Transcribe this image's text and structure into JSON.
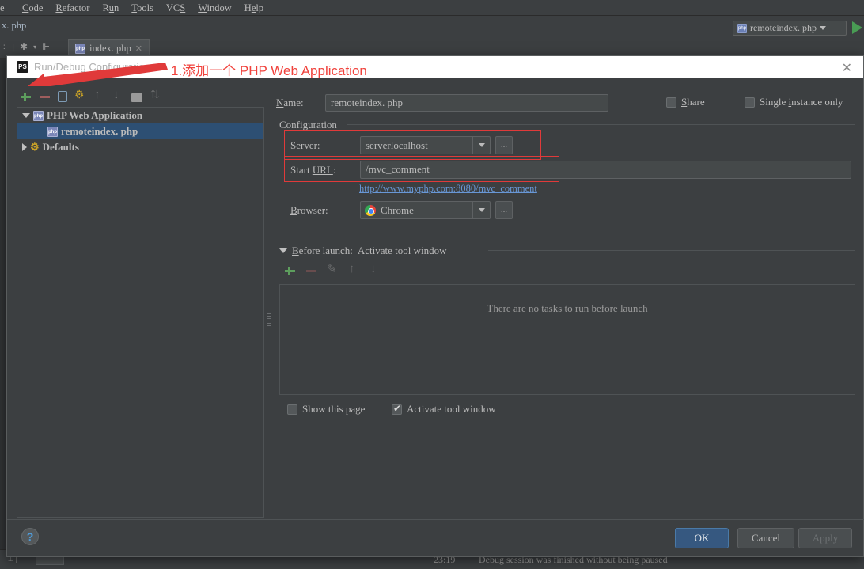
{
  "ide": {
    "menubar": [
      "Code",
      "Refactor",
      "Run",
      "Tools",
      "VCS",
      "Window",
      "Help"
    ],
    "menubar_clipped": "e",
    "breadcrumb": "x. php",
    "file_tab": "index. php",
    "run_config_widget": "remoteindex. php",
    "status": {
      "time": "23:19",
      "message": "Debug session was finished without being paused"
    }
  },
  "dialog": {
    "title": "Run/Debug Configurations",
    "annotation": "1.添加一个 PHP Web Application",
    "close_label": "✕",
    "left_panel": {
      "toolbar": [
        "add-icon",
        "remove-icon",
        "copy-icon",
        "edit-templates-icon",
        "move-up-icon",
        "move-down-icon",
        "folder-icon",
        "sort-icon"
      ],
      "tree": [
        {
          "label": "PHP Web Application",
          "level": 0,
          "expanded": true,
          "selected": false,
          "icon": "php-icon"
        },
        {
          "label": "remoteindex. php",
          "level": 1,
          "expanded": null,
          "selected": true,
          "icon": "php-icon"
        },
        {
          "label": "Defaults",
          "level": 0,
          "expanded": false,
          "selected": false,
          "icon": "defaults-icon"
        }
      ]
    },
    "name_label": "Name:",
    "name_label_u": "N",
    "name_value": "remoteindex. php",
    "share_label": "Share",
    "share_label_u": "S",
    "share_checked": false,
    "single_instance_label": "Single instance only",
    "single_instance_checked": false,
    "configuration_group": "Configuration",
    "server_label": "Server:",
    "server_label_u": "S",
    "server_value": "serverlocalhost",
    "server_dots": "...",
    "start_url_label": "Start URL:",
    "start_url_label_u": "URL",
    "start_url_value": "/mvc_comment",
    "resolved_url": "http://www.myphp.com:8080/mvc_comment",
    "browser_label": "Browser:",
    "browser_label_u": "B",
    "browser_value": "Chrome",
    "browser_dots": "...",
    "before_launch_label": "Before launch:",
    "before_launch_label_u": "B",
    "before_launch_value": "Activate tool window",
    "before_launch_toolbar": [
      "add-task-icon",
      "remove-task-icon",
      "edit-task-icon",
      "move-task-up-icon",
      "move-task-down-icon"
    ],
    "tasks_empty_text": "There are no tasks to run before launch",
    "show_this_page_label": "Show this page",
    "show_this_page_checked": false,
    "activate_tool_window_label": "Activate tool window",
    "activate_tool_window_checked": true,
    "buttons": {
      "ok": "OK",
      "cancel": "Cancel",
      "apply": "Apply"
    },
    "help_label": "?"
  },
  "colors": {
    "accent_red": "#e03a3a",
    "link_blue": "#6897d6",
    "primary_button": "#365880",
    "selection": "#2d4f73"
  }
}
